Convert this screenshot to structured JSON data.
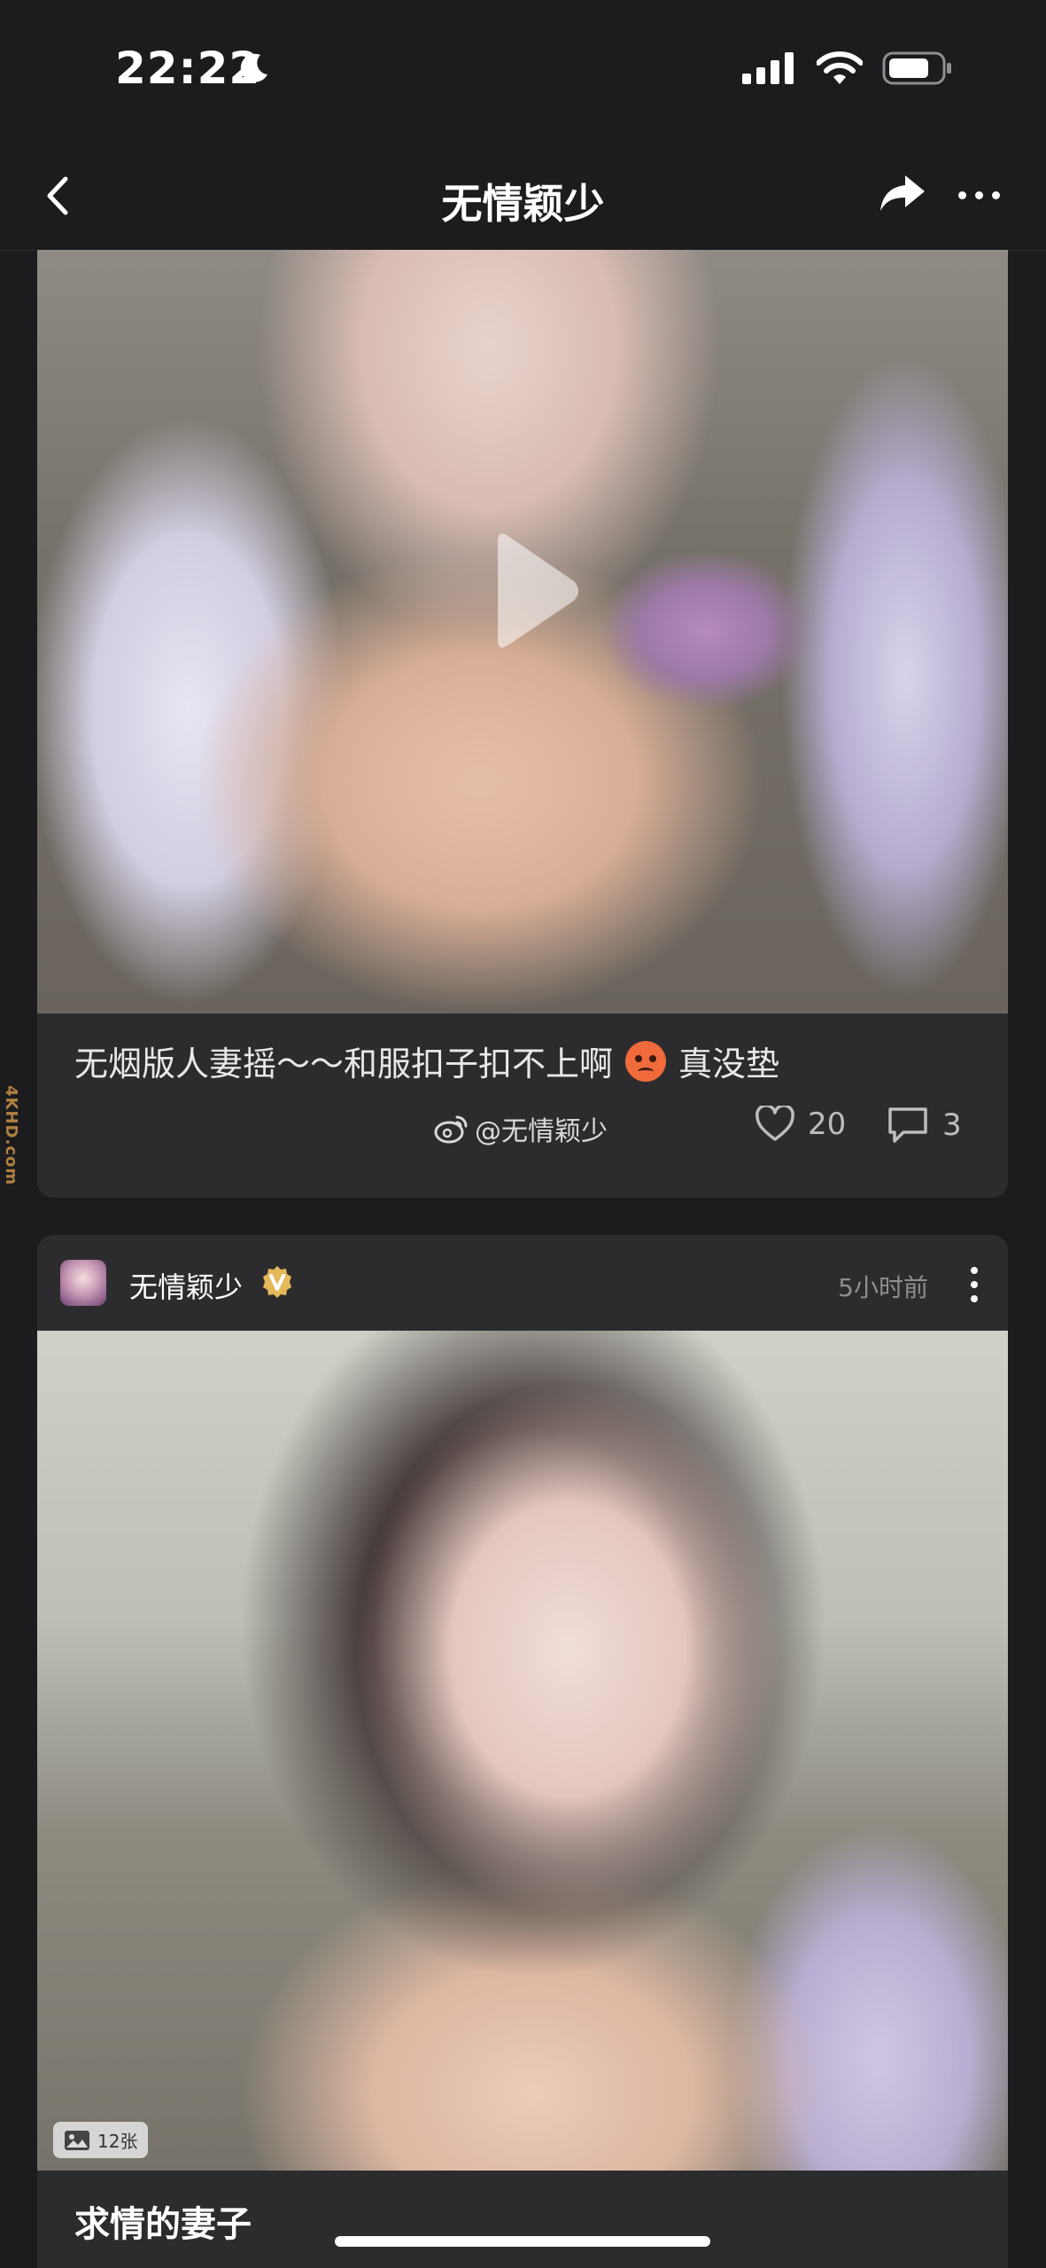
{
  "status_bar": {
    "time": "22:22"
  },
  "nav": {
    "title": "无情颖少"
  },
  "post1": {
    "caption": "无烟版人妻摇～～和服扣子扣不上啊",
    "caption_suffix": "真没垫",
    "source": "@无情颖少",
    "likes": "20",
    "comments": "3"
  },
  "post2": {
    "author": "无情颖少",
    "time": "5小时前",
    "image_count": "12张",
    "caption": "求情的妻子"
  },
  "watermark": "4KHD.com",
  "colors": {
    "background": "#1c1c1e",
    "card": "#2c2c2e",
    "muted": "#8e8e93",
    "verified": "#e5b85b"
  }
}
